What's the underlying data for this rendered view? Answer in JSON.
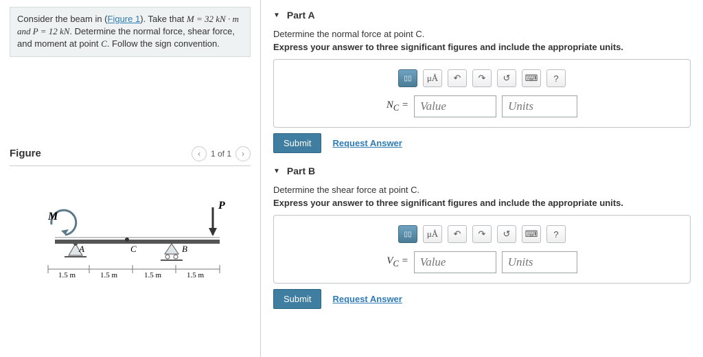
{
  "problem": {
    "prefix": "Consider the beam in (",
    "figure_link": "Figure 1",
    "suffix1": "). Take that ",
    "eq": "M = 32 kN · m and P = 12 kN",
    "suffix2": ". Determine the normal force, shear force, and moment at point ",
    "pointC": "C",
    "suffix3": ". Follow the sign convention."
  },
  "figure": {
    "title": "Figure",
    "pager": "1 of 1",
    "labels": {
      "M": "M",
      "P": "P",
      "A": "A",
      "B": "B",
      "C": "C",
      "dim": "1.5 m"
    }
  },
  "parts": [
    {
      "title": "Part A",
      "prompt": "Determine the normal force at point C.",
      "instruction": "Express your answer to three significant figures and include the appropriate units.",
      "var_html": "N",
      "sub": "C",
      "value_ph": "Value",
      "units_ph": "Units",
      "submit": "Submit",
      "request": "Request Answer"
    },
    {
      "title": "Part B",
      "prompt": "Determine the shear force at point C.",
      "instruction": "Express your answer to three significant figures and include the appropriate units.",
      "var_html": "V",
      "sub": "C",
      "value_ph": "Value",
      "units_ph": "Units",
      "submit": "Submit",
      "request": "Request Answer"
    }
  ],
  "toolbar": {
    "templates": "▭/▭",
    "mu": "μÅ",
    "undo": "↶",
    "redo": "↷",
    "reset": "↺",
    "keyboard": "⌨",
    "help": "?"
  }
}
